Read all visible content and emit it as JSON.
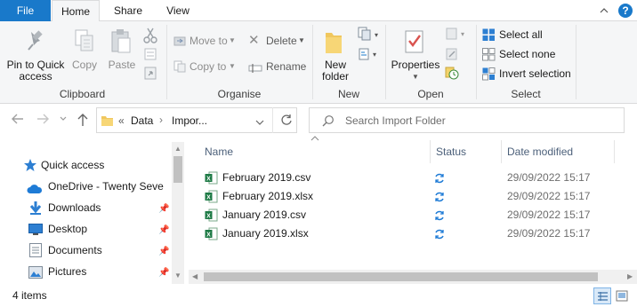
{
  "tabs": {
    "file": "File",
    "home": "Home",
    "share": "Share",
    "view": "View"
  },
  "ribbon": {
    "clipboard": {
      "label": "Clipboard",
      "pin_line1": "Pin to Quick",
      "pin_line2": "access",
      "copy": "Copy",
      "paste": "Paste"
    },
    "organise": {
      "label": "Organise",
      "move_to": "Move to",
      "copy_to": "Copy to",
      "delete": "Delete",
      "rename": "Rename"
    },
    "new": {
      "label": "New",
      "new_folder_line1": "New",
      "new_folder_line2": "folder"
    },
    "open": {
      "label": "Open",
      "properties": "Properties"
    },
    "select": {
      "label": "Select",
      "select_all": "Select all",
      "select_none": "Select none",
      "invert_selection": "Invert selection"
    }
  },
  "address": {
    "chevrons": "«",
    "crumb1": "Data",
    "sep": "›",
    "crumb2": "Impor..."
  },
  "search": {
    "placeholder": "Search Import Folder"
  },
  "nav": {
    "items": [
      {
        "label": "Quick access",
        "icon": "star-icon"
      },
      {
        "label": "OneDrive - Twenty Seve",
        "icon": "cloud-icon"
      },
      {
        "label": "Downloads",
        "icon": "download-icon"
      },
      {
        "label": "Desktop",
        "icon": "desktop-icon"
      },
      {
        "label": "Documents",
        "icon": "documents-icon"
      },
      {
        "label": "Pictures",
        "icon": "pictures-icon"
      }
    ]
  },
  "columns": {
    "name": "Name",
    "status": "Status",
    "date_modified": "Date modified"
  },
  "files": [
    {
      "name": "February 2019.csv",
      "date": "29/09/2022 15:17"
    },
    {
      "name": "February 2019.xlsx",
      "date": "29/09/2022 15:17"
    },
    {
      "name": "January 2019.csv",
      "date": "29/09/2022 15:17"
    },
    {
      "name": "January 2019.xlsx",
      "date": "29/09/2022 15:17"
    }
  ],
  "status_bar": {
    "item_count": "4 items"
  },
  "colors": {
    "accent": "#1979ca",
    "ribbon_bg": "#f5f6f7",
    "excel_green": "#1d7a45",
    "sync_blue": "#1e7bd6"
  }
}
